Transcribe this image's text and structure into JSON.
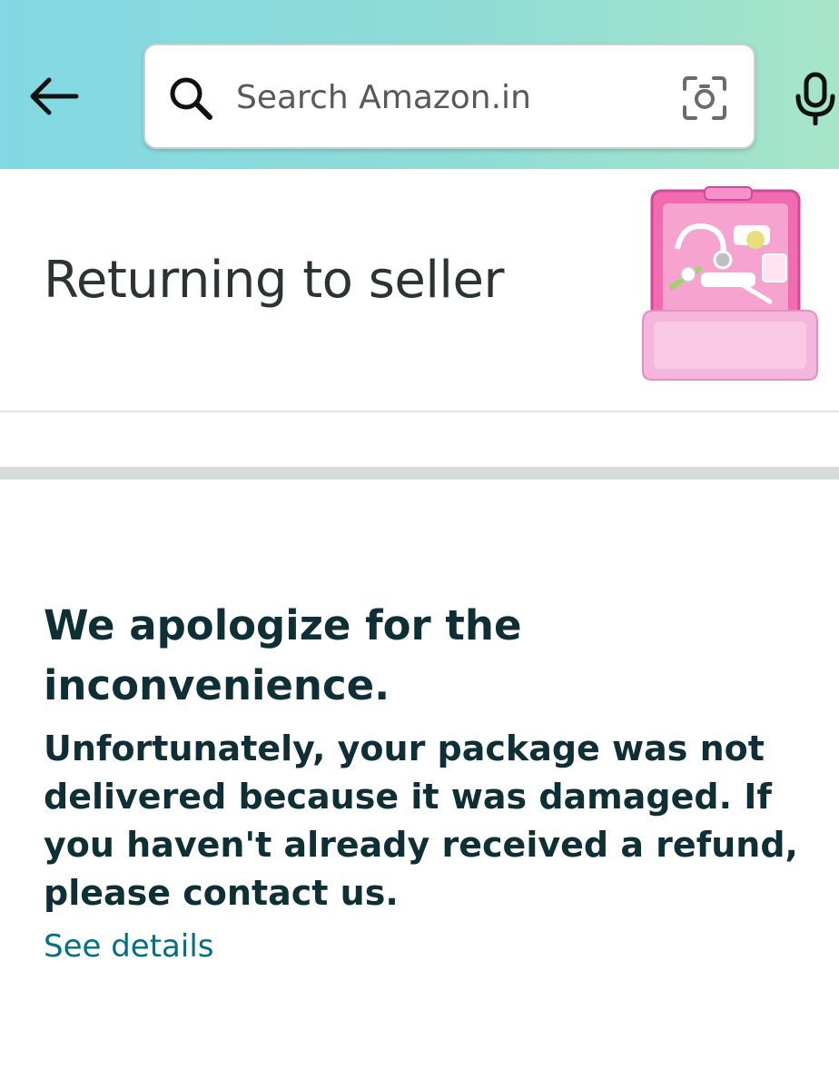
{
  "header": {
    "search": {
      "placeholder": "Search Amazon.in"
    },
    "icons": {
      "back": "arrow-left",
      "search": "magnifier",
      "camera": "camera-lens",
      "mic": "microphone"
    }
  },
  "order": {
    "status": "Returning to seller",
    "product_image": "pink toy doctor kit in carry case"
  },
  "message": {
    "heading": "We apologize for the inconvenience.",
    "body": "Unfortunately, your package was not delivered because it was damaged. If you haven't already received a refund, please contact us.",
    "link": "See details"
  },
  "colors": {
    "header_gradient": [
      "#82d8e3",
      "#a6e5c8"
    ],
    "heading_text": "#0f2f36",
    "link": "#007185",
    "divider": "#d5dbdb"
  }
}
